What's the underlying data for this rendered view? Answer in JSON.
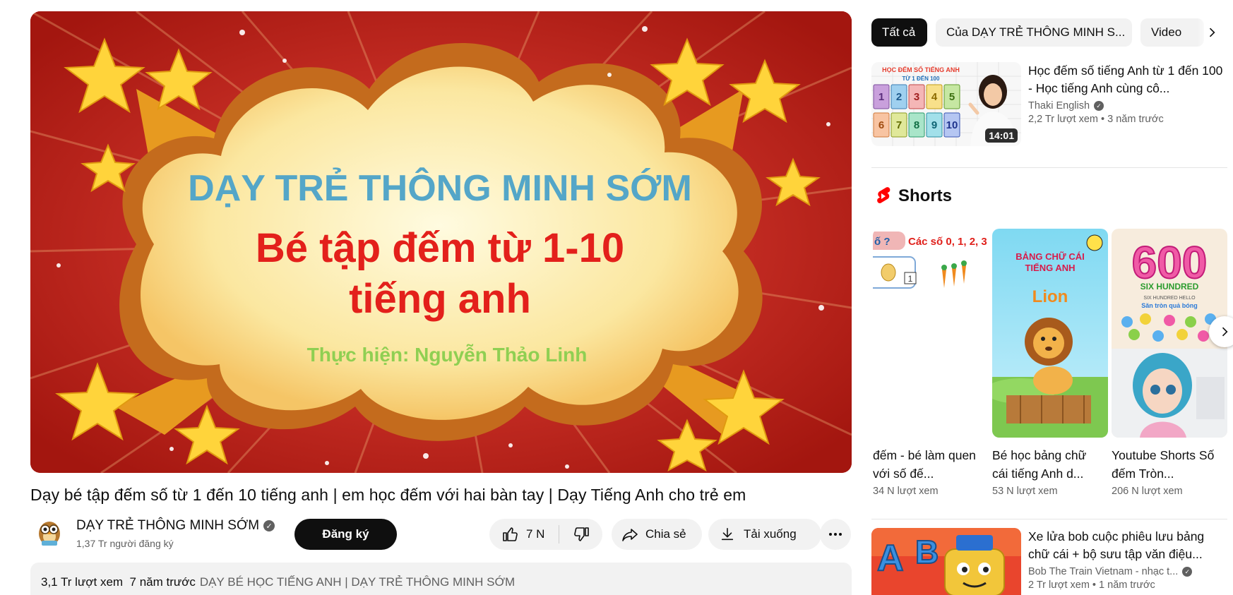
{
  "player": {
    "overlay_title_1": "DẠY TRẺ THÔNG MINH SỚM",
    "overlay_title_2": "Bé tập đếm từ 1-10",
    "overlay_title_3": "tiếng anh",
    "overlay_credit": "Thực hiện: Nguyễn Thảo Linh"
  },
  "video": {
    "title": "Dạy bé tập đếm số từ 1 đến 10 tiếng anh | em học đếm với hai bàn tay | Dạy Tiếng Anh cho trẻ em",
    "channel_name": "DẠY TRẺ THÔNG MINH SỚM",
    "subscribers": "1,37 Tr người đăng ký",
    "subscribe_label": "Đăng ký",
    "like_count": "7 N",
    "share_label": "Chia sẻ",
    "download_label": "Tải xuống",
    "views": "3,1 Tr lượt xem",
    "age": "7 năm trước",
    "tags": "DẠY BÉ HỌC TIẾNG ANH | DẠY TRẺ THÔNG MINH SỚM"
  },
  "chips": [
    {
      "label": "Tất cả",
      "active": true
    },
    {
      "label": "Của DẠY TRẺ THÔNG MINH S...",
      "active": false
    },
    {
      "label": "Video",
      "active": false
    }
  ],
  "recommendations": [
    {
      "title": "Học đếm số tiếng Anh từ 1 đến 100 - Học tiếng Anh cùng cô...",
      "channel": "Thaki English",
      "views": "2,2 Tr lượt xem",
      "age": "3 năm trước",
      "duration": "14:01",
      "thumb_heading": "HỌC ĐẾM SỐ TIẾNG ANH",
      "thumb_sub": "TỪ 1 ĐẾN 100"
    },
    {
      "title": "Xe lửa bob cuộc phiêu lưu bảng chữ cái + bộ sưu tập văn điệu...",
      "channel": "Bob The Train Vietnam - nhạc t...",
      "views": "2 Tr lượt xem",
      "age": "1 năm trước"
    }
  ],
  "shorts": {
    "heading": "Shorts",
    "items": [
      {
        "title": "đếm - bé làm quen với số đế...",
        "views": "34 N lượt xem",
        "thumb_text_1": "ố ?",
        "thumb_text_2": "Các số 0, 1, 2, 3",
        "thumb_num": "1"
      },
      {
        "title": "Bé học bảng chữ cái tiếng Anh d...",
        "views": "53 N lượt xem",
        "thumb_text_1": "BẢNG CHỮ CÁI",
        "thumb_text_2": "TIẾNG ANH",
        "thumb_word": "Lion"
      },
      {
        "title": "Youtube Shorts Số đếm Tròn...",
        "views": "206 N lượt xem",
        "thumb_num": "600",
        "thumb_text_1": "SIX HUNDRED",
        "thumb_text_2": "SIX HUNDRED HELLO",
        "thumb_text_3": "Săn tròn quả bóng"
      }
    ]
  },
  "colors": {
    "brand_red": "#ff0000",
    "accent_dark": "#0f0f0f",
    "muted_text": "#606060",
    "pill_bg": "#f2f2f2"
  }
}
